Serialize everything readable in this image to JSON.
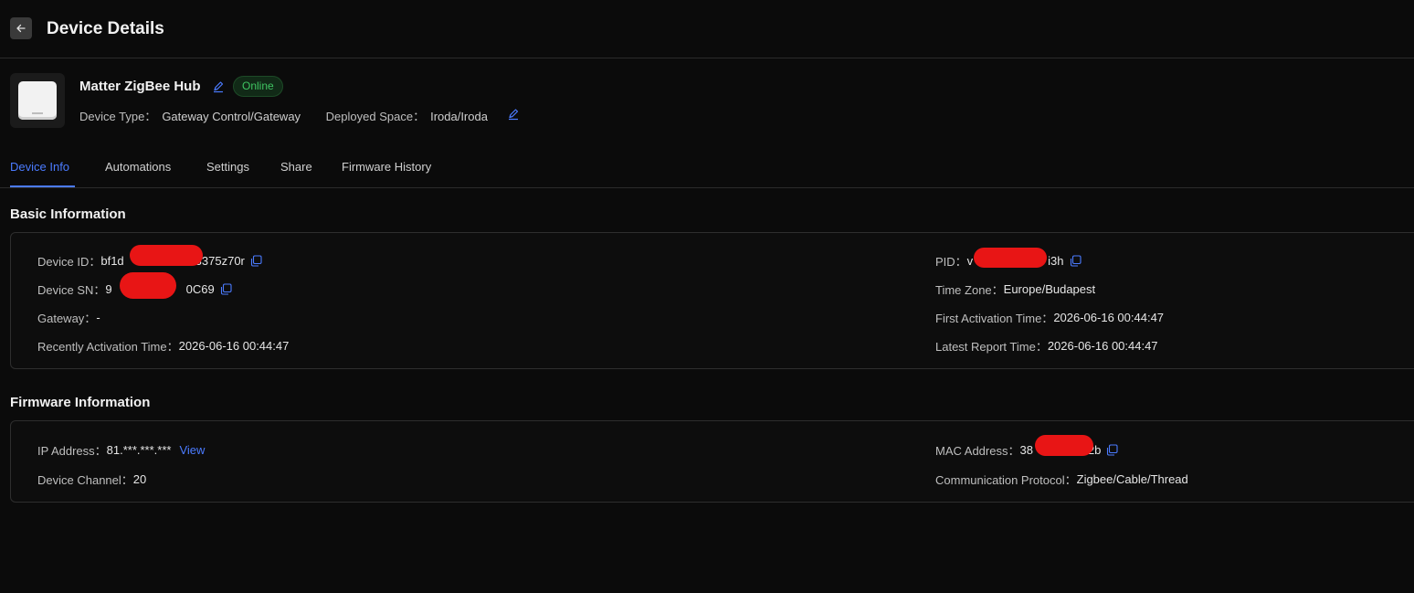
{
  "header": {
    "back_icon": "arrow-left-icon",
    "title": "Device Details"
  },
  "device": {
    "name": "Matter ZigBee Hub",
    "status": "Online",
    "status_color": "#3fc562",
    "type_label": "Device Type：",
    "type_value": "Gateway Control/Gateway",
    "space_label": "Deployed Space：",
    "space_value": "Iroda/Iroda"
  },
  "tabs": [
    {
      "label": "Device Info",
      "active": true
    },
    {
      "label": "Automations",
      "active": false
    },
    {
      "label": "Settings",
      "active": false
    },
    {
      "label": "Share",
      "active": false
    },
    {
      "label": "Firmware History",
      "active": false
    }
  ],
  "basic": {
    "title": "Basic Information",
    "device_id_label": "Device ID：",
    "device_id_prefix": "bf1d",
    "device_id_suffix": "3375z70r",
    "device_sn_label": "Device SN：",
    "device_sn_prefix": "9",
    "device_sn_suffix": "0C69",
    "gateway_label": "Gateway：",
    "gateway_value": "-",
    "recent_activation_label": "Recently Activation Time：",
    "recent_activation_value": "2026-06-16 00:44:47",
    "pid_label": "PID：",
    "pid_prefix": "v",
    "pid_suffix": "i3h",
    "timezone_label": "Time Zone：",
    "timezone_value": "Europe/Budapest",
    "first_activation_label": "First Activation Time：",
    "first_activation_value": "2026-06-16 00:44:47",
    "latest_report_label": "Latest Report Time：",
    "latest_report_value": "2026-06-16 00:44:47"
  },
  "firmware": {
    "title": "Firmware Information",
    "ip_label": "IP Address：",
    "ip_value": "81.***.***.***",
    "ip_view": "View",
    "channel_label": "Device Channel：",
    "channel_value": "20",
    "mac_label": "MAC Address：",
    "mac_prefix": "38",
    "mac_suffix": "2b",
    "protocol_label": "Communication Protocol：",
    "protocol_value": "Zigbee/Cable/Thread"
  },
  "colors": {
    "accent": "#4b7bff",
    "background": "#0b0b0b",
    "redaction": "#e81515"
  }
}
